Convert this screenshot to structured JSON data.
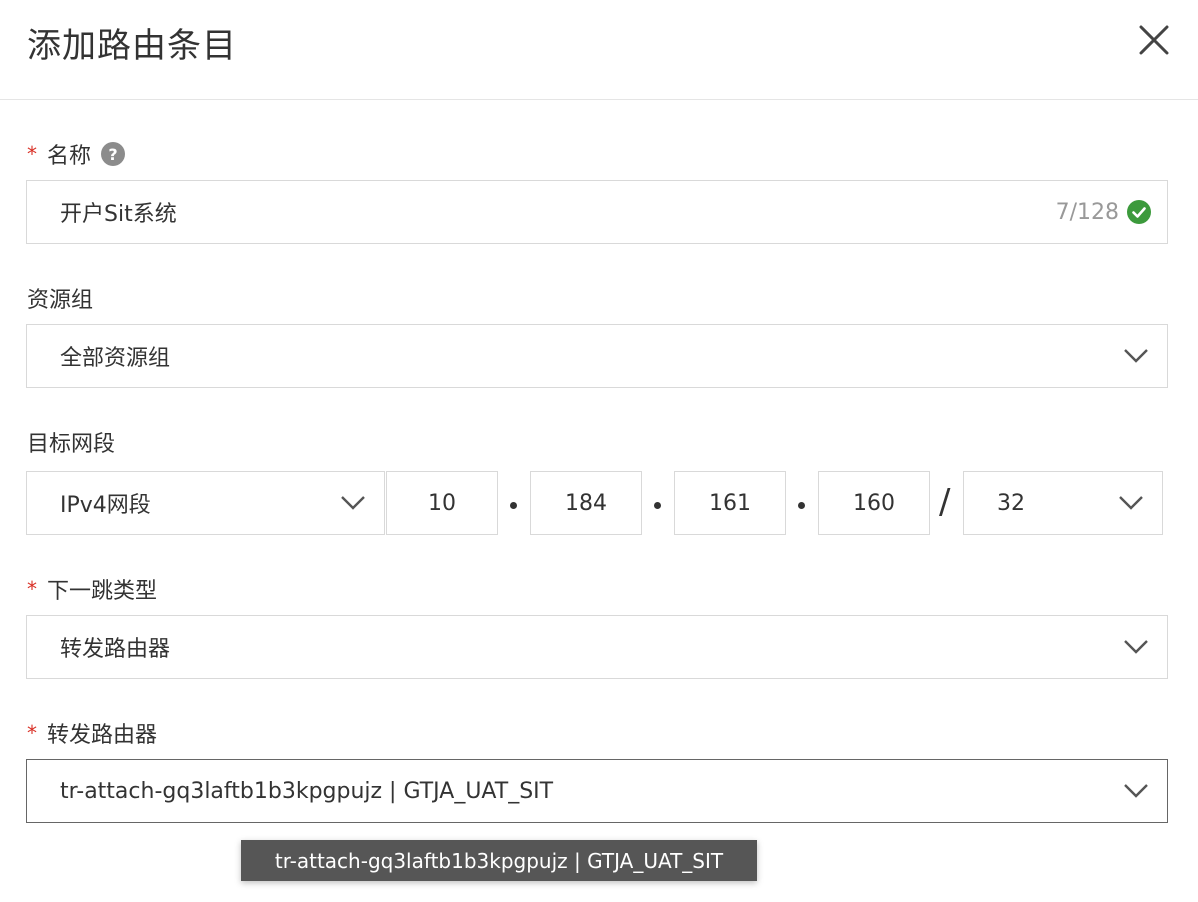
{
  "dialog": {
    "title": "添加路由条目"
  },
  "name_field": {
    "label": "名称",
    "value": "开户Sit系统",
    "counter": "7/128"
  },
  "resource_group": {
    "label": "资源组",
    "value": "全部资源组"
  },
  "target": {
    "label": "目标网段",
    "type": "IPv4网段",
    "octets": [
      "10",
      "184",
      "161",
      "160"
    ],
    "mask": "32"
  },
  "next_hop_type": {
    "label": "下一跳类型",
    "value": "转发路由器"
  },
  "forward_router": {
    "label": "转发路由器",
    "value": "tr-attach-gq3laftb1b3kpgpujz | GTJA_UAT_SIT"
  },
  "tooltip": {
    "text": "tr-attach-gq3laftb1b3kpgpujz | GTJA_UAT_SIT"
  },
  "colors": {
    "required": "#d93026",
    "success": "#3c9a3c",
    "tooltip_bg": "#565656"
  }
}
